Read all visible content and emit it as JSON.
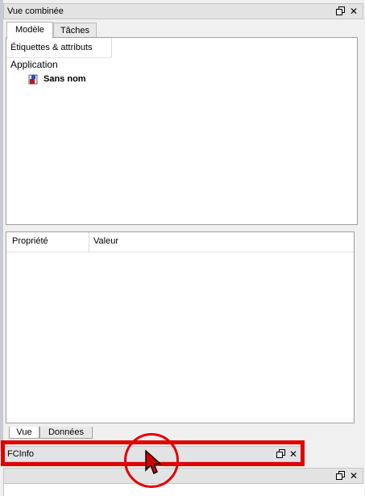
{
  "combo_view": {
    "title": "Vue combinée",
    "tabs": [
      {
        "label": "Modèle",
        "active": true
      },
      {
        "label": "Tâches",
        "active": false
      }
    ],
    "tree": {
      "header": "Étiquettes & attributs",
      "root": "Application",
      "document": "Sans nom",
      "document_icon": "document-icon"
    },
    "properties": {
      "columns": [
        "Propriété",
        "Valeur"
      ]
    },
    "bottom_tabs": [
      {
        "label": "Vue",
        "active": true
      },
      {
        "label": "Données",
        "active": false
      }
    ]
  },
  "fcinfo": {
    "title": "FCInfo"
  },
  "annotation": {
    "highlight_color": "#e00000",
    "cursor_color": "#d40000"
  }
}
